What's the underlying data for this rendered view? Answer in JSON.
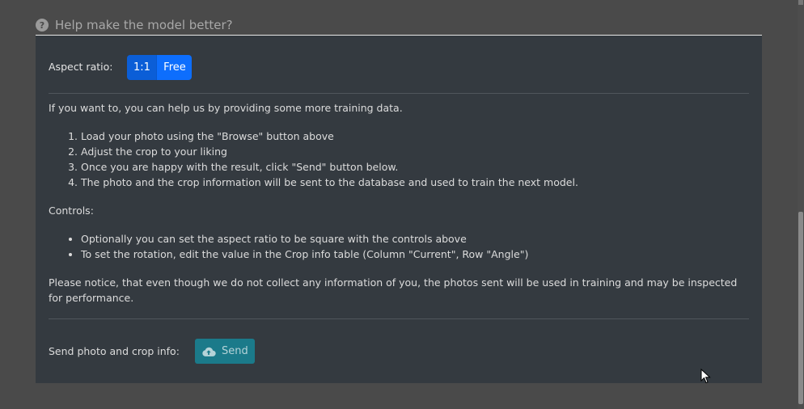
{
  "header": {
    "title": "Help make the model better?",
    "icon": "question-circle-icon"
  },
  "aspect": {
    "label": "Aspect ratio:",
    "options": [
      "1:1",
      "Free"
    ],
    "selected": "1:1"
  },
  "intro": "If you want to, you can help us by providing some more training data.",
  "steps": [
    "Load your photo using the \"Browse\" button above",
    "Adjust the crop to your liking",
    "Once you are happy with the result, click \"Send\" button below.",
    "The photo and the crop information will be sent to the database and used to train the next model."
  ],
  "controls": {
    "heading": "Controls:",
    "items": [
      "Optionally you can set the aspect ratio to be square with the controls above",
      "To set the rotation, edit the value in the Crop info table (Column \"Current\", Row \"Angle\")"
    ]
  },
  "notice": "Please notice, that even though we do not collect any information of you, the photos sent will be used in training and may be inspected for performance.",
  "send": {
    "label": "Send photo and crop info:",
    "button": "Send",
    "icon": "cloud-upload-icon"
  },
  "colors": {
    "panel": "#343a40",
    "accent": "#0d6efd",
    "send_button": "#1b7a8a"
  }
}
